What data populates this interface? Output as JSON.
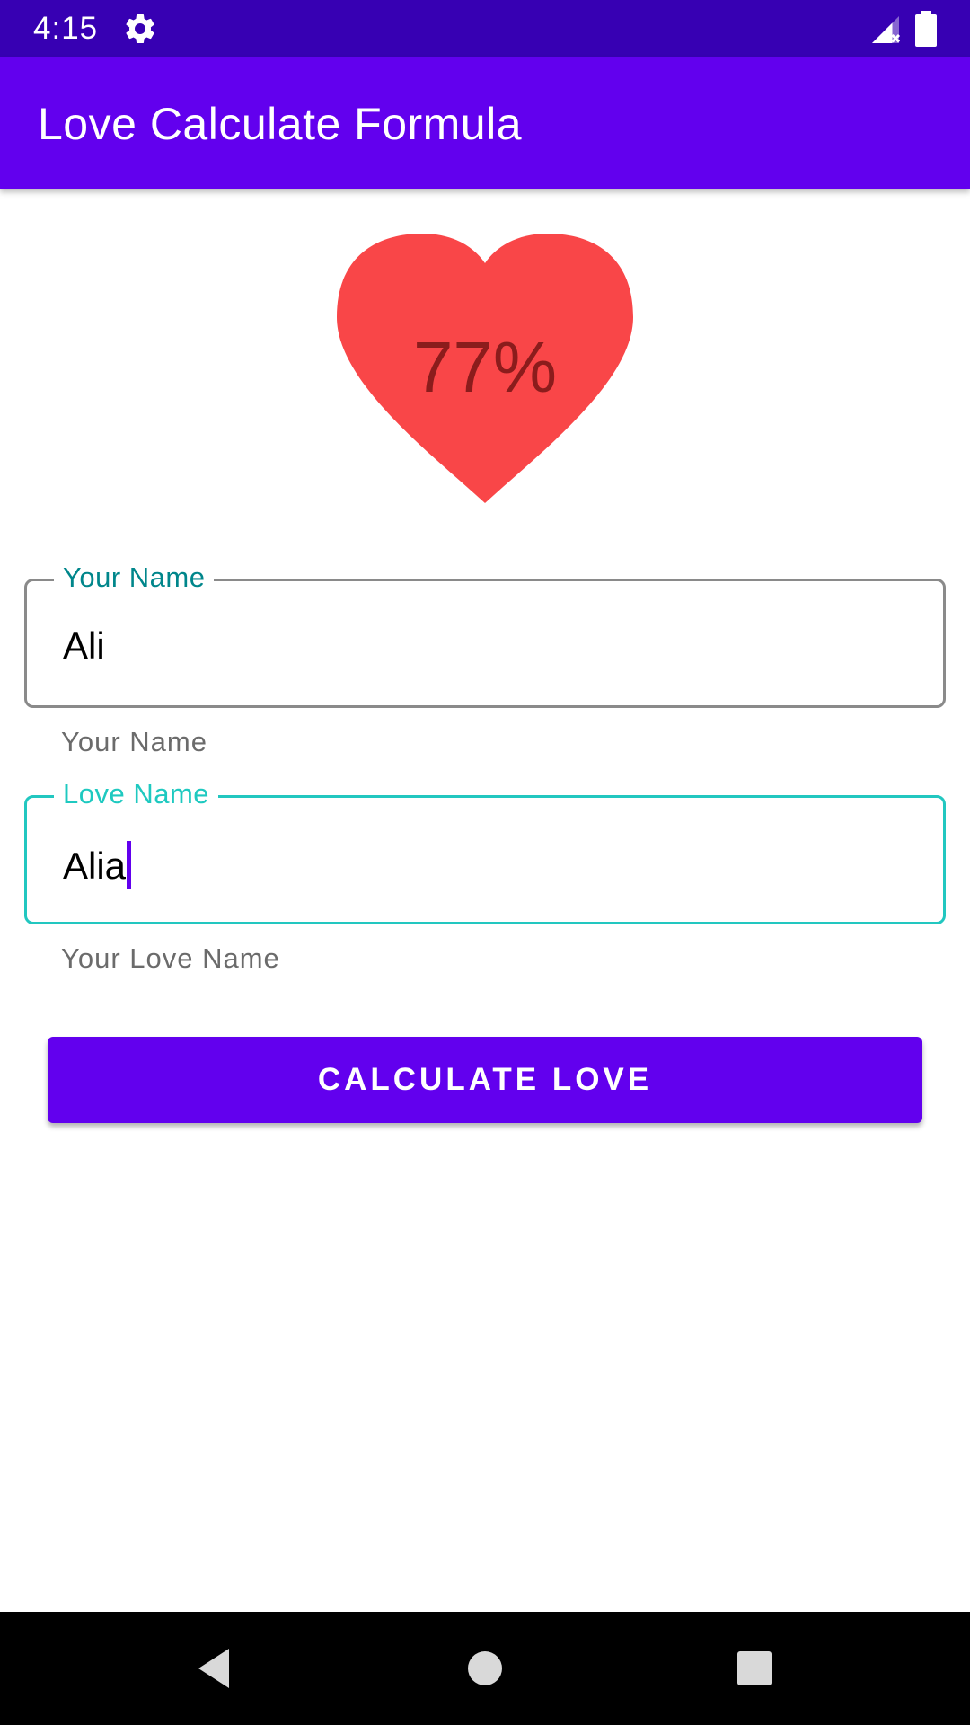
{
  "status_bar": {
    "time": "4:15",
    "icons": [
      "gear-icon",
      "signal-icon",
      "battery-icon"
    ]
  },
  "app_bar": {
    "title": "Love Calculate Formula"
  },
  "result": {
    "percent_text": "77%",
    "heart_color": "#f94648",
    "percent_color": "#8b1c1c"
  },
  "your_name": {
    "label": "Your Name",
    "value": "Ali",
    "helper": "Your Name"
  },
  "love_name": {
    "label": "Love Name",
    "value": "Alia",
    "helper": "Your Love Name"
  },
  "calculate_button": {
    "label": "CALCULATE LOVE"
  },
  "nav_bar": {
    "icons": [
      "back-icon",
      "home-icon",
      "recents-icon"
    ]
  },
  "colors": {
    "primary": "#6200ee",
    "primary_dark": "#3700b3",
    "focus_accent": "#1ec9c0"
  }
}
